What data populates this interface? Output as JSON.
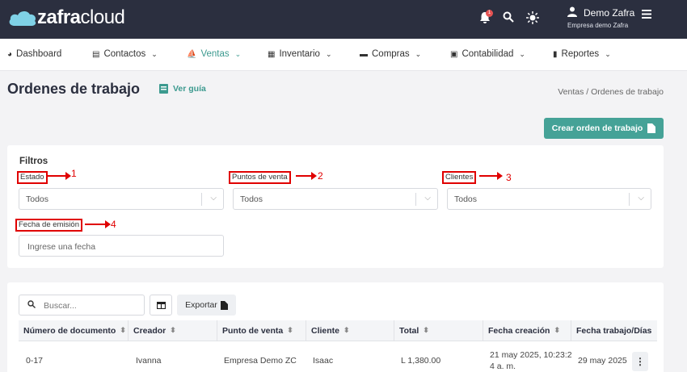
{
  "app": {
    "logo_bold": "zafra",
    "logo_light": "cloud"
  },
  "topbar": {
    "notif_count": "1",
    "user_name": "Demo Zafra",
    "company": "Empresa demo Zafra"
  },
  "nav": [
    {
      "label": "Dashboard",
      "icon": "dashboard-icon"
    },
    {
      "label": "Contactos",
      "icon": "contacts-icon"
    },
    {
      "label": "Ventas",
      "icon": "sales-icon"
    },
    {
      "label": "Inventario",
      "icon": "inventory-icon"
    },
    {
      "label": "Compras",
      "icon": "purchases-icon"
    },
    {
      "label": "Contabilidad",
      "icon": "accounting-icon"
    },
    {
      "label": "Reportes",
      "icon": "reports-icon"
    }
  ],
  "page": {
    "title": "Ordenes de trabajo",
    "guide": "Ver guía",
    "breadcrumb": "Ventas  /  Ordenes de trabajo",
    "create_btn": "Crear orden de trabajo"
  },
  "filters": {
    "title": "Filtros",
    "estado_label": "Estado",
    "estado_value": "Todos",
    "puntos_label": "Puntos de venta",
    "puntos_value": "Todos",
    "clientes_label": "Clientes",
    "clientes_value": "Todos",
    "fecha_label": "Fecha de emisión",
    "fecha_placeholder": "Ingrese una fecha",
    "annotations": [
      "1",
      "2",
      "3",
      "4"
    ]
  },
  "table": {
    "search_placeholder": "Buscar...",
    "export_label": "Exportar",
    "headers": [
      "Número de documento",
      "Creador",
      "Punto de venta",
      "Cliente",
      "Total",
      "Fecha creación",
      "Fecha trabajo/Días"
    ],
    "rows": [
      [
        "0-17",
        "Ivanna",
        "Empresa Demo ZC",
        "Isaac",
        "L 1,380.00",
        "21 may 2025, 10:23:2",
        "4 a. m.",
        "29 may 2025"
      ]
    ]
  },
  "colors": {
    "accent": "#45a297",
    "topbar": "#2b2f3f",
    "annotation": "#e00000"
  }
}
